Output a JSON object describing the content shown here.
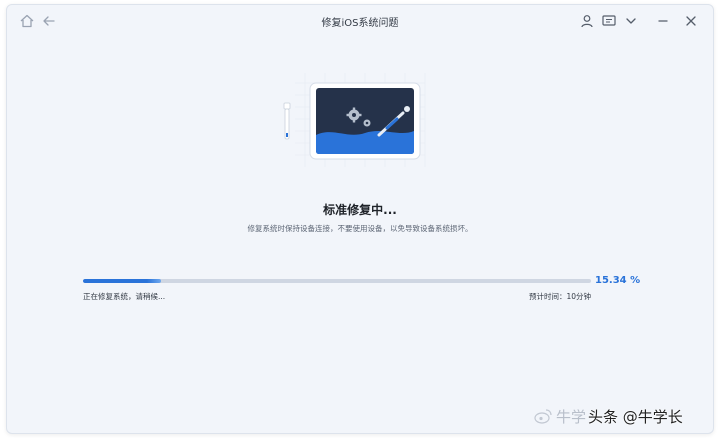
{
  "window": {
    "title": "修复iOS系统问题",
    "icons": [
      "home-icon",
      "back-arrow-icon",
      "user-icon",
      "feedback-icon",
      "chevron-down-icon",
      "minimize-icon",
      "close-icon"
    ]
  },
  "main": {
    "heading": "标准修复中...",
    "description": "修复系统时保持设备连接，不要使用设备，以免导致设备系统损坏。"
  },
  "progress": {
    "value": 15.34,
    "percent_label": "15.34 %",
    "status_text": "正在修复系统，请稍候...",
    "eta_label": "预计时间：",
    "eta_value": "10分钟"
  },
  "watermark": {
    "faint_text": "牛学",
    "text": "头条 @牛学长"
  },
  "colors": {
    "accent": "#2a73d9",
    "background": "#f2f5fa",
    "screen": "#25324a"
  }
}
